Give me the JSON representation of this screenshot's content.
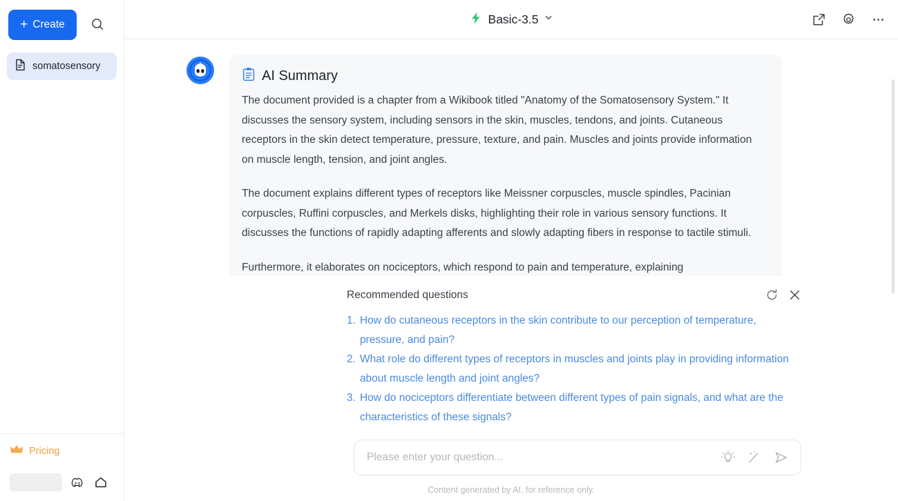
{
  "sidebar": {
    "create_label": "Create",
    "create_icon": "plus-icon",
    "search_icon": "search-icon",
    "documents": [
      {
        "label": "somatosensory",
        "icon": "document-icon",
        "selected": true
      }
    ],
    "pricing_label": "Pricing",
    "pricing_icon": "crown-icon",
    "footer_icons": [
      "discord-icon",
      "home-icon"
    ]
  },
  "topbar": {
    "model_name": "Basic-3.5",
    "model_icon": "lightning-bolt-icon",
    "model_chevron": "chevron-down-icon",
    "actions": [
      {
        "name": "share-icon",
        "glyph": "external-link"
      },
      {
        "name": "settings-icon",
        "glyph": "gear"
      },
      {
        "name": "more-icon",
        "glyph": "ellipsis"
      }
    ]
  },
  "message": {
    "avatar_icon": "bot-avatar-icon",
    "summary_icon": "clipboard-icon",
    "summary_title": "AI Summary",
    "paragraphs": [
      "The document provided is a chapter from a Wikibook titled \"Anatomy of the Somatosensory System.\" It discusses the sensory system, including sensors in the skin, muscles, tendons, and joints. Cutaneous receptors in the skin detect temperature, pressure, texture, and pain. Muscles and joints provide information on muscle length, tension, and joint angles.",
      "The document explains different types of receptors like Meissner corpuscles, muscle spindles, Pacinian corpuscles, Ruffini corpuscles, and Merkels disks, highlighting their role in various sensory functions. It discusses the functions of rapidly adapting afferents and slowly adapting fibers in response to tactile stimuli.",
      "Furthermore, it elaborates on nociceptors, which respond to pain and temperature, explaining"
    ]
  },
  "recommended": {
    "title": "Recommended questions",
    "refresh_icon": "refresh-icon",
    "close_icon": "close-icon",
    "questions": [
      {
        "num": "1.",
        "text": "How do cutaneous receptors in the skin contribute to our perception of temperature, pressure, and pain?"
      },
      {
        "num": "2.",
        "text": "What role do different types of receptors in muscles and joints play in providing information about muscle length and joint angles?"
      },
      {
        "num": "3.",
        "text": "How do nociceptors differentiate between different types of pain signals, and what are the characteristics of these signals?"
      }
    ]
  },
  "composer": {
    "placeholder": "Please enter your question...",
    "value": "",
    "icons": [
      {
        "name": "lightbulb-icon"
      },
      {
        "name": "magic-wand-icon"
      },
      {
        "name": "send-icon"
      }
    ]
  },
  "footer": {
    "disclaimer": "Content generated by AI, for reference only."
  },
  "colors": {
    "accent_blue": "#1769f0",
    "link_blue": "#4a8ae0",
    "pricing_orange": "#f0a13c",
    "bolt_green": "#36c474",
    "bubble_bg": "#f7f8fa"
  }
}
